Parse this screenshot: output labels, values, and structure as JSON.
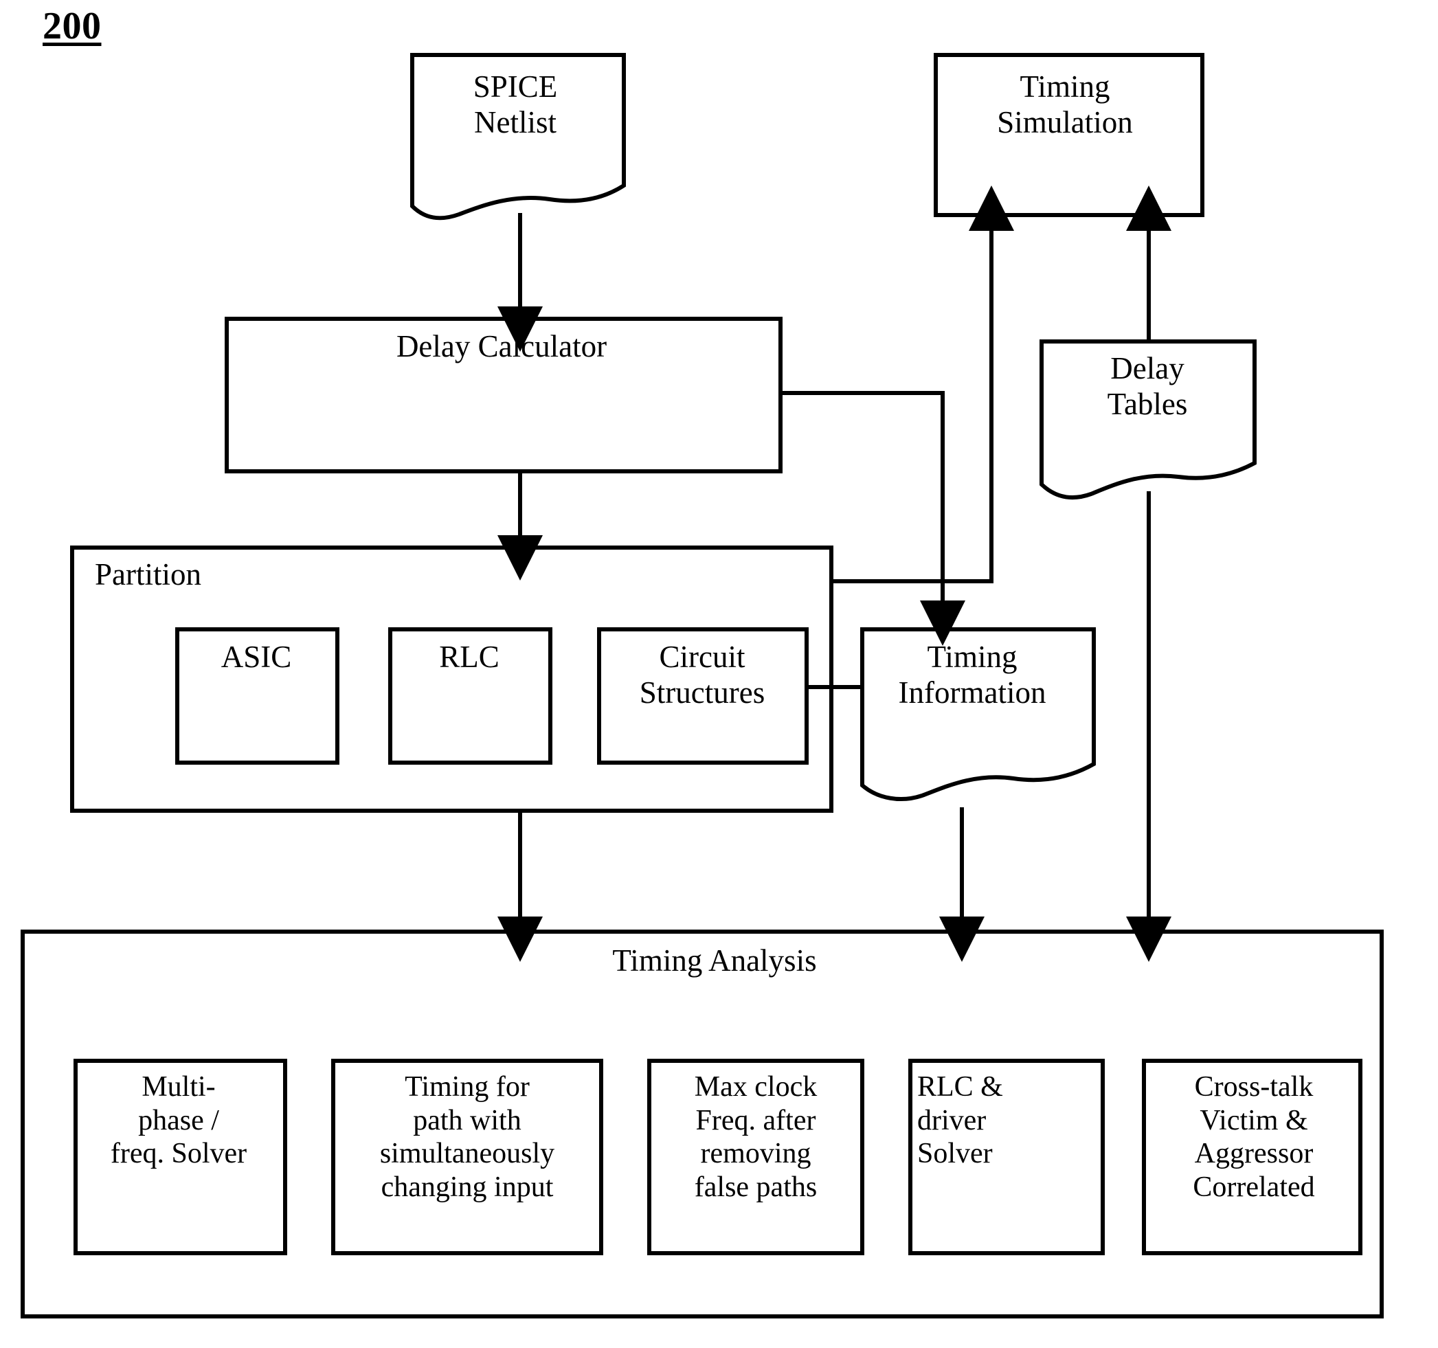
{
  "figure": {
    "number": "200",
    "type": "patent-flow-diagram"
  },
  "nodes": {
    "spice_netlist": {
      "label": "SPICE\nNetlist",
      "shape": "document"
    },
    "timing_simulation": {
      "label": "Timing\nSimulation",
      "shape": "rectangle"
    },
    "delay_calculator": {
      "label": "Delay Calculator",
      "shape": "rectangle"
    },
    "delay_tables": {
      "label": "Delay\nTables",
      "shape": "document"
    },
    "partition": {
      "label": "Partition",
      "shape": "rectangle"
    },
    "asic": {
      "label": "ASIC",
      "shape": "rectangle"
    },
    "rlc": {
      "label": "RLC",
      "shape": "rectangle"
    },
    "circuit_structures": {
      "label": "Circuit\nStructures",
      "shape": "rectangle"
    },
    "timing_information": {
      "label": "Timing\nInformation",
      "shape": "document"
    },
    "timing_analysis": {
      "label": "Timing Analysis",
      "shape": "rectangle"
    }
  },
  "timing_analysis_items": [
    {
      "label": "Multi-\nphase /\nfreq. Solver"
    },
    {
      "label": "Timing for\npath with\nsimultaneously\nchanging input"
    },
    {
      "label": "Max clock\nFreq. after\nremoving\nfalse paths"
    },
    {
      "label": "RLC &\ndriver\nSolver"
    },
    {
      "label": "Cross-talk\nVictim &\nAggressor\nCorrelated"
    }
  ],
  "style": {
    "line_color": "#000000",
    "background": "#ffffff",
    "fill": "#ffffff"
  }
}
